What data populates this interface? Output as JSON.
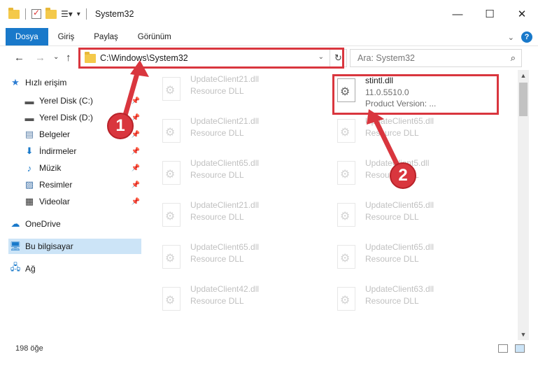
{
  "window": {
    "title": "System32",
    "controls": {
      "minimize": "—",
      "maximize": "☐",
      "close": "✕"
    }
  },
  "ribbon": {
    "tabs": [
      "Dosya",
      "Giriş",
      "Paylaş",
      "Görünüm"
    ],
    "expand_icon": "chevron-down-icon",
    "help_label": "?"
  },
  "address": {
    "path": "C:\\Windows\\System32",
    "dropdown": "⌄",
    "refresh": "↻"
  },
  "search": {
    "placeholder": "Ara: System32",
    "icon": "🔍"
  },
  "nav": {
    "back": "←",
    "forward": "→",
    "recent": "⌄",
    "up": "↑"
  },
  "sidebar": {
    "quick_access": "Hızlı erişim",
    "items": [
      {
        "label": "Yerel Disk (C:)",
        "icon": "drive-icon",
        "pinned": true
      },
      {
        "label": "Yerel Disk (D:)",
        "icon": "drive-icon",
        "pinned": true
      },
      {
        "label": "Belgeler",
        "icon": "documents-icon",
        "pinned": true
      },
      {
        "label": "İndirmeler",
        "icon": "download-icon",
        "pinned": true
      },
      {
        "label": "Müzik",
        "icon": "music-icon",
        "pinned": true
      },
      {
        "label": "Resimler",
        "icon": "pictures-icon",
        "pinned": true
      },
      {
        "label": "Videolar",
        "icon": "videos-icon",
        "pinned": true
      }
    ],
    "onedrive": "OneDrive",
    "this_pc": "Bu bilgisayar",
    "network": "Ağ"
  },
  "files": {
    "left_column": [
      {
        "name": "UpdateClient21.dll",
        "type": "Resource DLL"
      },
      {
        "name": "UpdateClient21.dll",
        "type": "Resource DLL"
      },
      {
        "name": "UpdateClient65.dll",
        "type": "Resource DLL"
      },
      {
        "name": "UpdateClient21.dll",
        "type": "Resource DLL"
      },
      {
        "name": "UpdateClient65.dll",
        "type": "Resource DLL"
      },
      {
        "name": "UpdateClient42.dll",
        "type": "Resource DLL"
      }
    ],
    "right_column": [
      {
        "name": "stintl.dll",
        "type": "11.0.5510.0",
        "extra": "Product Version:   ..."
      },
      {
        "name": "UpdateClient65.dll",
        "type": "Resource DLL"
      },
      {
        "name": "UpdateClient5.dll",
        "type": "Resource DLL"
      },
      {
        "name": "UpdateClient65.dll",
        "type": "Resource DLL"
      },
      {
        "name": "UpdateClient65.dll",
        "type": "Resource DLL"
      },
      {
        "name": "UpdateClient63.dll",
        "type": "Resource DLL"
      }
    ]
  },
  "status": {
    "count": "198 öğe"
  },
  "annotations": {
    "marker1": "1",
    "marker2": "2"
  },
  "colors": {
    "accent": "#1979ca",
    "highlight": "#d9363e",
    "selected": "#cce4f7"
  }
}
